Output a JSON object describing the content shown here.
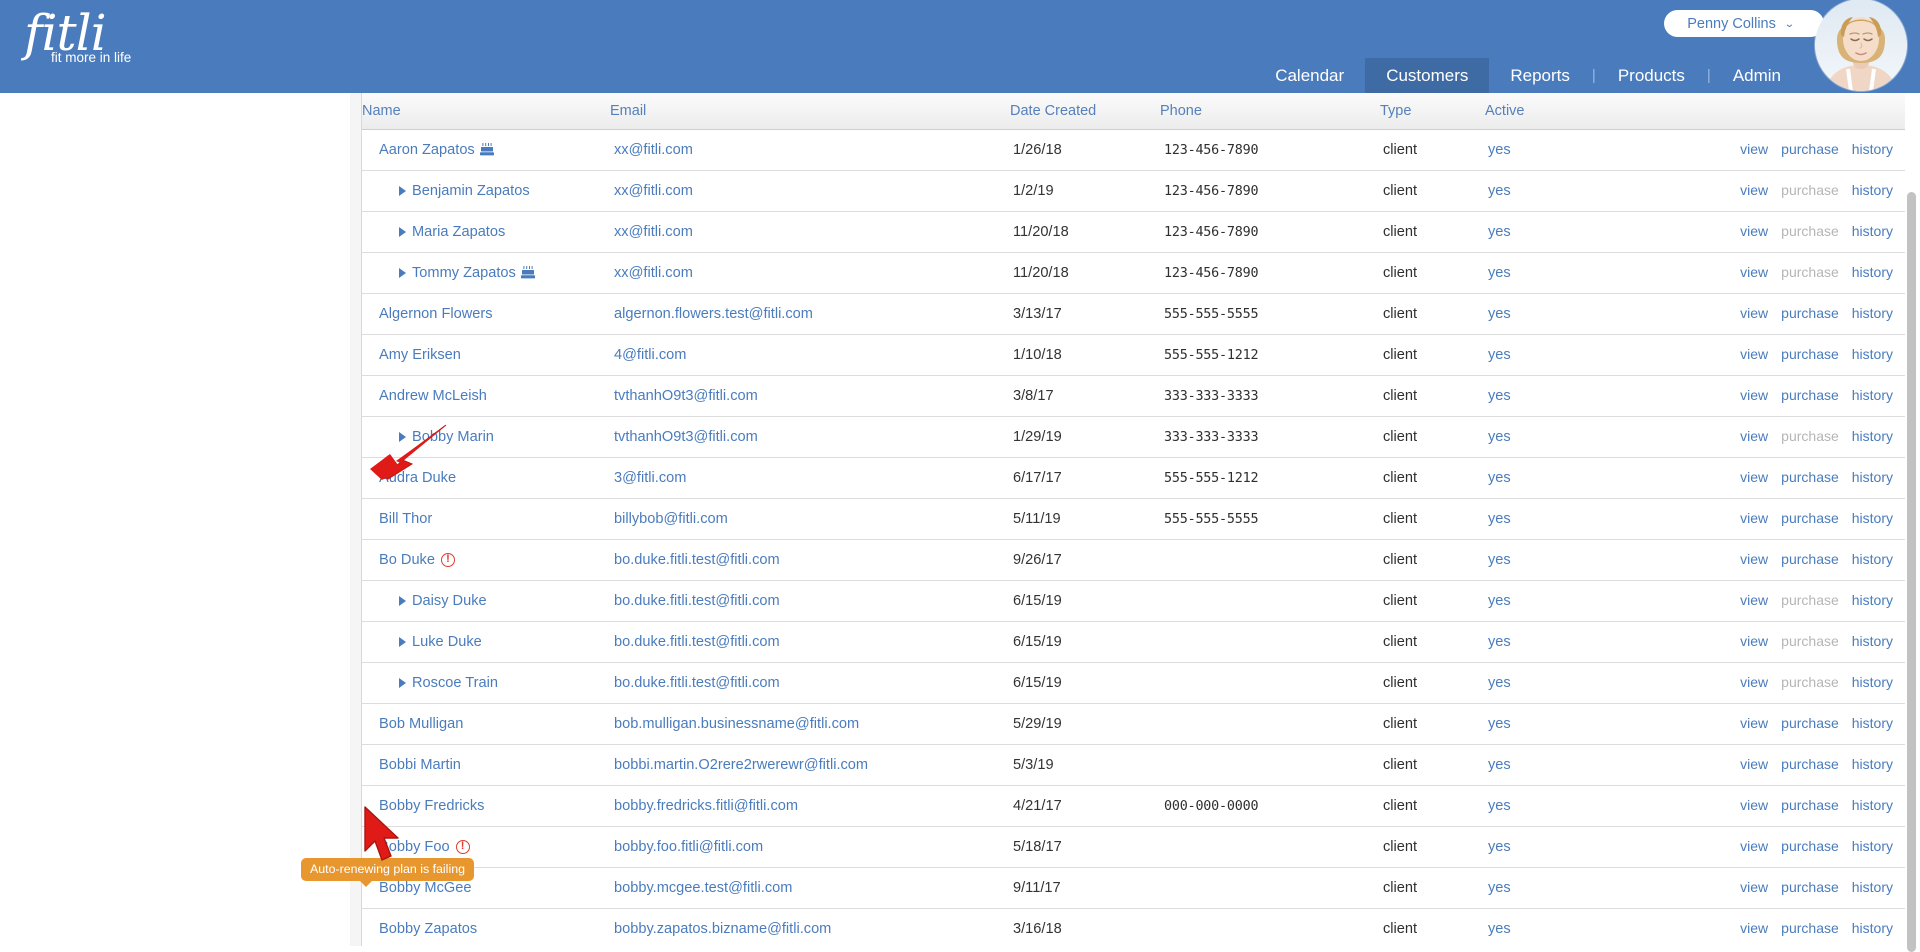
{
  "header": {
    "logo_text": "fitli",
    "logo_tagline": "fit more in life",
    "user_name": "Penny Collins",
    "chevron": "chevron-down",
    "nav": [
      {
        "label": "Calendar",
        "active": false,
        "sep_after": false
      },
      {
        "label": "Customers",
        "active": true,
        "sep_after": false
      },
      {
        "label": "Reports",
        "active": false,
        "sep_after": true
      },
      {
        "label": "Products",
        "active": false,
        "sep_after": true
      },
      {
        "label": "Admin",
        "active": false,
        "sep_after": false
      }
    ]
  },
  "table": {
    "columns": [
      "Name",
      "Email",
      "Date Created",
      "Phone",
      "Type",
      "Active"
    ],
    "action_labels": {
      "view": "view",
      "purchase": "purchase",
      "history": "history"
    },
    "rows": [
      {
        "name": "Aaron Zapatos",
        "child": false,
        "cake": true,
        "warn": false,
        "email": "xx@fitli.com",
        "date": "1/26/18",
        "phone": "123-456-7890",
        "type": "client",
        "active": "yes",
        "purchase_enabled": true
      },
      {
        "name": "Benjamin Zapatos",
        "child": true,
        "cake": false,
        "warn": false,
        "email": "xx@fitli.com",
        "date": "1/2/19",
        "phone": "123-456-7890",
        "type": "client",
        "active": "yes",
        "purchase_enabled": false
      },
      {
        "name": "Maria Zapatos",
        "child": true,
        "cake": false,
        "warn": false,
        "email": "xx@fitli.com",
        "date": "11/20/18",
        "phone": "123-456-7890",
        "type": "client",
        "active": "yes",
        "purchase_enabled": false
      },
      {
        "name": "Tommy Zapatos",
        "child": true,
        "cake": true,
        "warn": false,
        "email": "xx@fitli.com",
        "date": "11/20/18",
        "phone": "123-456-7890",
        "type": "client",
        "active": "yes",
        "purchase_enabled": false
      },
      {
        "name": "Algernon Flowers",
        "child": false,
        "cake": false,
        "warn": false,
        "email": "algernon.flowers.test@fitli.com",
        "date": "3/13/17",
        "phone": "555-555-5555",
        "type": "client",
        "active": "yes",
        "purchase_enabled": true
      },
      {
        "name": "Amy Eriksen",
        "child": false,
        "cake": false,
        "warn": false,
        "email": "4@fitli.com",
        "date": "1/10/18",
        "phone": "555-555-1212",
        "type": "client",
        "active": "yes",
        "purchase_enabled": true
      },
      {
        "name": "Andrew McLeish",
        "child": false,
        "cake": false,
        "warn": false,
        "email": "tvthanhO9t3@fitli.com",
        "date": "3/8/17",
        "phone": "333-333-3333",
        "type": "client",
        "active": "yes",
        "purchase_enabled": true
      },
      {
        "name": "Bobby Marin",
        "child": true,
        "cake": false,
        "warn": false,
        "email": "tvthanhO9t3@fitli.com",
        "date": "1/29/19",
        "phone": "333-333-3333",
        "type": "client",
        "active": "yes",
        "purchase_enabled": false
      },
      {
        "name": "Audra Duke",
        "child": false,
        "cake": false,
        "warn": false,
        "email": "3@fitli.com",
        "date": "6/17/17",
        "phone": "555-555-1212",
        "type": "client",
        "active": "yes",
        "purchase_enabled": true
      },
      {
        "name": "Bill Thor",
        "child": false,
        "cake": false,
        "warn": false,
        "email": "billybob@fitli.com",
        "date": "5/11/19",
        "phone": "555-555-5555",
        "type": "client",
        "active": "yes",
        "purchase_enabled": true
      },
      {
        "name": "Bo Duke",
        "child": false,
        "cake": false,
        "warn": true,
        "email": "bo.duke.fitli.test@fitli.com",
        "date": "9/26/17",
        "phone": "",
        "type": "client",
        "active": "yes",
        "purchase_enabled": true
      },
      {
        "name": "Daisy Duke",
        "child": true,
        "cake": false,
        "warn": false,
        "email": "bo.duke.fitli.test@fitli.com",
        "date": "6/15/19",
        "phone": "",
        "type": "client",
        "active": "yes",
        "purchase_enabled": false
      },
      {
        "name": "Luke Duke",
        "child": true,
        "cake": false,
        "warn": false,
        "email": "bo.duke.fitli.test@fitli.com",
        "date": "6/15/19",
        "phone": "",
        "type": "client",
        "active": "yes",
        "purchase_enabled": false
      },
      {
        "name": "Roscoe Train",
        "child": true,
        "cake": false,
        "warn": false,
        "email": "bo.duke.fitli.test@fitli.com",
        "date": "6/15/19",
        "phone": "",
        "type": "client",
        "active": "yes",
        "purchase_enabled": false
      },
      {
        "name": "Bob Mulligan",
        "child": false,
        "cake": false,
        "warn": false,
        "email": "bob.mulligan.businessname@fitli.com",
        "date": "5/29/19",
        "phone": "",
        "type": "client",
        "active": "yes",
        "purchase_enabled": true
      },
      {
        "name": "Bobbi Martin",
        "child": false,
        "cake": false,
        "warn": false,
        "email": "bobbi.martin.O2rere2rwerewr@fitli.com",
        "date": "5/3/19",
        "phone": "",
        "type": "client",
        "active": "yes",
        "purchase_enabled": true
      },
      {
        "name": "Bobby Fredricks",
        "child": false,
        "cake": false,
        "warn": false,
        "email": "bobby.fredricks.fitli@fitli.com",
        "date": "4/21/17",
        "phone": "000-000-0000",
        "type": "client",
        "active": "yes",
        "purchase_enabled": true
      },
      {
        "name": "Bobby Foo",
        "child": false,
        "cake": false,
        "warn": true,
        "email": "bobby.foo.fitli@fitli.com",
        "date": "5/18/17",
        "phone": "",
        "type": "client",
        "active": "yes",
        "purchase_enabled": true
      },
      {
        "name": "Bobby McGee",
        "child": false,
        "cake": false,
        "warn": false,
        "email": "bobby.mcgee.test@fitli.com",
        "date": "9/11/17",
        "phone": "",
        "type": "client",
        "active": "yes",
        "purchase_enabled": true
      },
      {
        "name": "Bobby Zapatos",
        "child": false,
        "cake": false,
        "warn": false,
        "email": "bobby.zapatos.bizname@fitli.com",
        "date": "3/16/18",
        "phone": "",
        "type": "client",
        "active": "yes",
        "purchase_enabled": true
      }
    ]
  },
  "annotations": {
    "tooltip_text": "Auto-renewing plan is failing",
    "arrow_color": "#e01b17",
    "tooltip_bg": "#e8972e"
  },
  "colors": {
    "brand_blue": "#4a7cbd",
    "nav_active": "#3f6ba5",
    "link_blue": "#4a7cbd",
    "warn_red": "#e13b2e"
  }
}
